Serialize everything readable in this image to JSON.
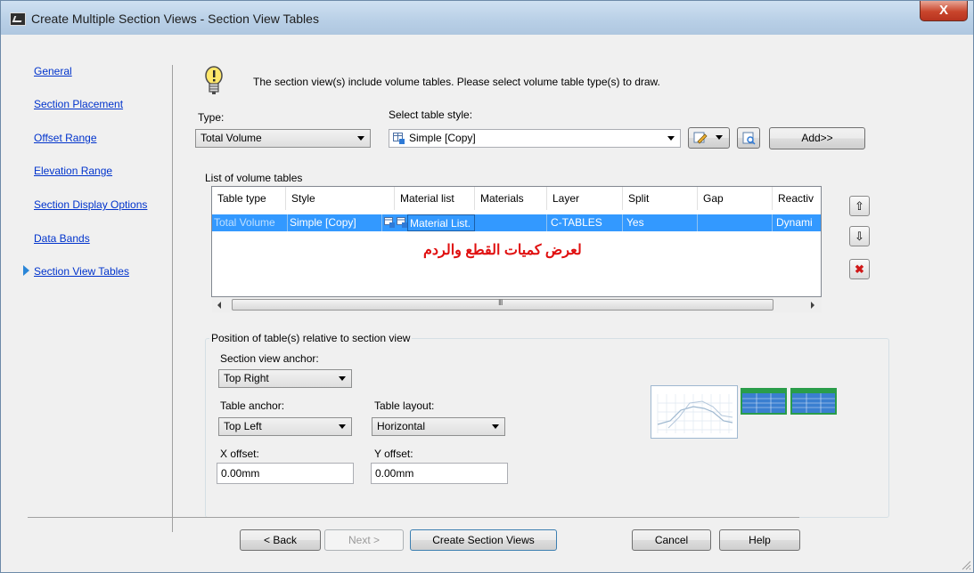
{
  "window": {
    "title": "Create Multiple Section Views - Section View Tables",
    "close_label": "X"
  },
  "nav": {
    "items": [
      "General",
      "Section Placement",
      "Offset Range",
      "Elevation Range",
      "Section Display Options",
      "Data Bands",
      "Section View Tables"
    ]
  },
  "info": {
    "message": "The section view(s) include volume tables. Please select volume table type(s) to draw."
  },
  "type_field": {
    "label": "Type:",
    "value": "Total Volume"
  },
  "style_field": {
    "label": "Select table style:",
    "value": "Simple [Copy]"
  },
  "add_button": "Add>>",
  "volume_tables": {
    "label": "List of volume tables",
    "columns": [
      "Table type",
      "Style",
      "Material list",
      "Materials",
      "Layer",
      "Split",
      "Gap",
      "Reactiv"
    ],
    "rows": [
      {
        "table_type": "Total Volume",
        "style": "Simple [Copy]",
        "material_list": "Material List.",
        "materials": "",
        "layer": "C-TABLES",
        "split": "Yes",
        "gap": "",
        "reactivity": "Dynami"
      }
    ],
    "annotation": "لعرض كميات القطع والردم",
    "scroll_mark": "III"
  },
  "side_buttons": {
    "up": "⇧",
    "down": "⇩",
    "delete": "✖"
  },
  "position": {
    "label": "Position of table(s) relative to section view",
    "anchor_label": "Section view anchor:",
    "anchor_value": "Top Right",
    "table_anchor_label": "Table anchor:",
    "table_anchor_value": "Top Left",
    "layout_label": "Table layout:",
    "layout_value": "Horizontal",
    "x_offset_label": "X offset:",
    "x_offset_value": "0.00mm",
    "y_offset_label": "Y offset:",
    "y_offset_value": "0.00mm"
  },
  "footer": {
    "back": "< Back",
    "next": "Next >",
    "create": "Create Section Views",
    "cancel": "Cancel",
    "help": "Help"
  },
  "colors": {
    "selection": "#3399ff",
    "link": "#0033cc",
    "annotation": "#e01010",
    "close": "#c9452c"
  }
}
